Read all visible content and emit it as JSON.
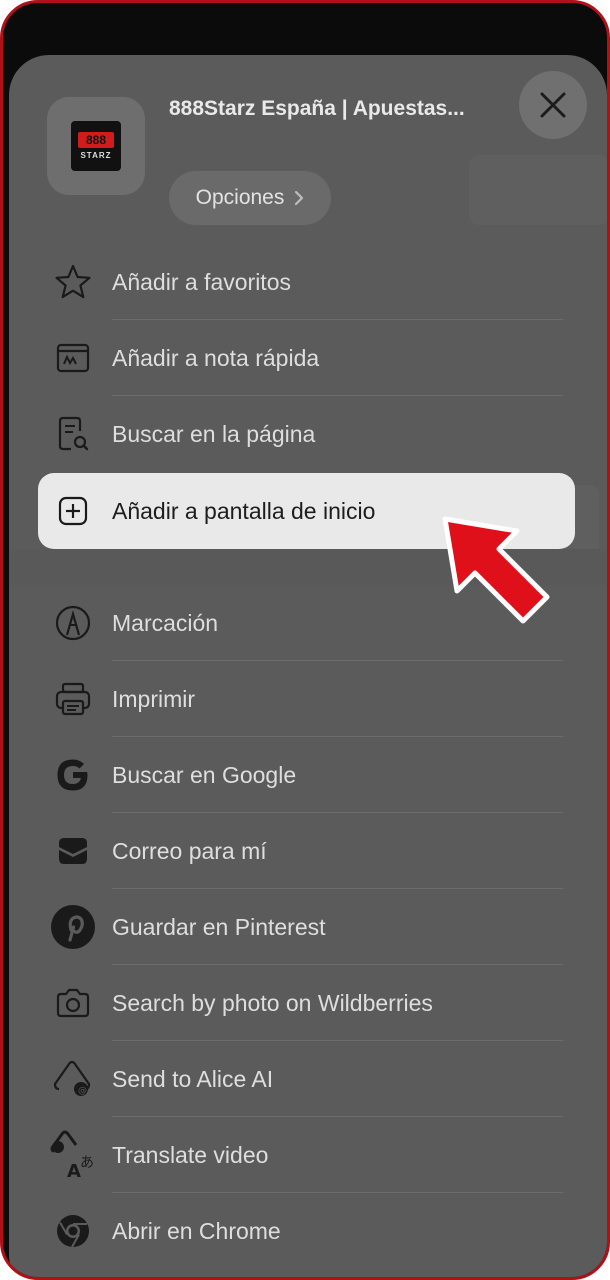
{
  "header": {
    "site_title": "888Starz España | Apuestas...",
    "options_label": "Opciones",
    "logo_number": "888",
    "logo_text": "STARZ"
  },
  "menu": {
    "group1": [
      {
        "label": "Añadir a favoritos",
        "icon": "star-icon"
      },
      {
        "label": "Añadir a nota rápida",
        "icon": "quick-note-icon"
      },
      {
        "label": "Buscar en la página",
        "icon": "find-in-page-icon"
      }
    ],
    "highlighted": {
      "label": "Añadir a pantalla de inicio",
      "icon": "add-square-icon"
    },
    "group2": [
      {
        "label": "Marcación",
        "icon": "markup-pen-icon"
      },
      {
        "label": "Imprimir",
        "icon": "printer-icon"
      },
      {
        "label": "Buscar en Google",
        "icon": "google-icon"
      },
      {
        "label": "Correo para mí",
        "icon": "mail-tray-icon"
      },
      {
        "label": "Guardar en Pinterest",
        "icon": "pinterest-icon"
      },
      {
        "label": "Search by photo on Wildberries",
        "icon": "camera-icon"
      },
      {
        "label": "Send to Alice AI",
        "icon": "alice-icon"
      },
      {
        "label": "Translate video",
        "icon": "translate-icon"
      },
      {
        "label": "Abrir en Chrome",
        "icon": "chrome-icon"
      }
    ]
  },
  "colors": {
    "frame_border": "#b01018",
    "sheet": "#5b5b5b",
    "highlight": "#e9e9e9",
    "arrow": "#e0101a"
  }
}
